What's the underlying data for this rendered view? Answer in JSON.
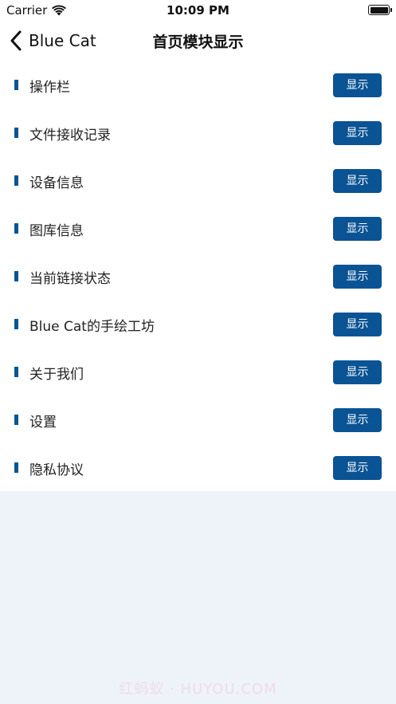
{
  "status_bar": {
    "carrier": "Carrier",
    "time": "10:09 PM"
  },
  "nav": {
    "back_label": "Blue Cat",
    "title": "首页模块显示"
  },
  "accent_color": "#0a5394",
  "modules": [
    {
      "label": "操作栏",
      "button": "显示"
    },
    {
      "label": "文件接收记录",
      "button": "显示"
    },
    {
      "label": "设备信息",
      "button": "显示"
    },
    {
      "label": "图库信息",
      "button": "显示"
    },
    {
      "label": "当前链接状态",
      "button": "显示"
    },
    {
      "label": "Blue Cat的手绘工坊",
      "button": "显示"
    },
    {
      "label": "关于我们",
      "button": "显示"
    },
    {
      "label": "设置",
      "button": "显示"
    },
    {
      "label": "隐私协议",
      "button": "显示"
    }
  ],
  "watermark": "红蚂蚁 · HUYOU.COM"
}
